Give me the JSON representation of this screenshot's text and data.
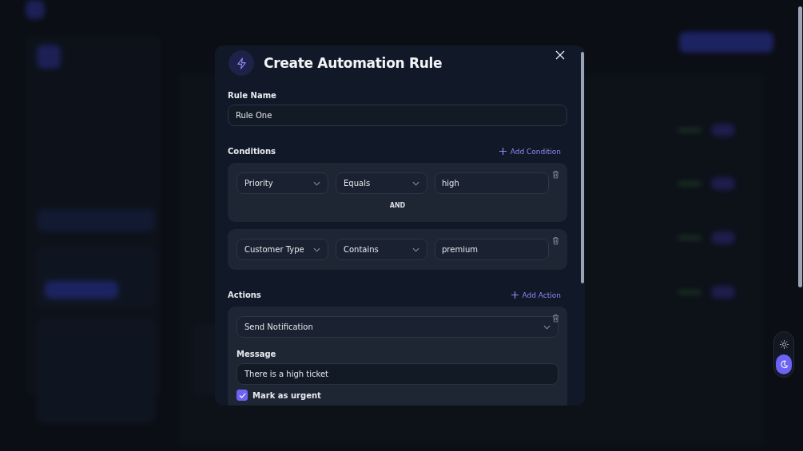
{
  "modal": {
    "title": "Create Automation Rule",
    "rule_name": {
      "label": "Rule Name",
      "value": "Rule One"
    },
    "conditions": {
      "label": "Conditions",
      "add_label": "Add Condition",
      "items": [
        {
          "field": "Priority",
          "operator": "Equals",
          "value": "high",
          "connector": "AND"
        },
        {
          "field": "Customer Type",
          "operator": "Contains",
          "value": "premium"
        }
      ]
    },
    "actions": {
      "label": "Actions",
      "add_label": "Add Action",
      "items": [
        {
          "type": "Send Notification",
          "message_label": "Message",
          "message": "There is a high ticket",
          "urgent_label": "Mark as urgent",
          "checked": true
        }
      ]
    }
  },
  "theme_toggle": [
    {
      "kind": "light",
      "selected": false
    },
    {
      "kind": "dark",
      "selected": true
    }
  ]
}
